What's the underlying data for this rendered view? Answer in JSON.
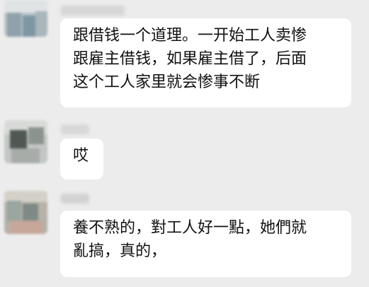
{
  "chat": {
    "messages": [
      {
        "avatar": "blurred-contact-avatar",
        "sender": "",
        "lines": [
          "跟借钱一个道理。一开始工人卖惨",
          "跟雇主借钱，如果雇主借了，后面",
          "这个工人家里就会惨事不断"
        ]
      },
      {
        "avatar": "blurred-contact-avatar",
        "sender": "",
        "lines": [
          "哎"
        ]
      },
      {
        "avatar": "blurred-contact-avatar",
        "sender": "",
        "lines": [
          "養不熟的，對工人好一點，她們就",
          "亂搞，真的，"
        ]
      }
    ]
  },
  "colors": {
    "background": "#ececec",
    "bubble": "#ffffff",
    "text": "#111111"
  }
}
